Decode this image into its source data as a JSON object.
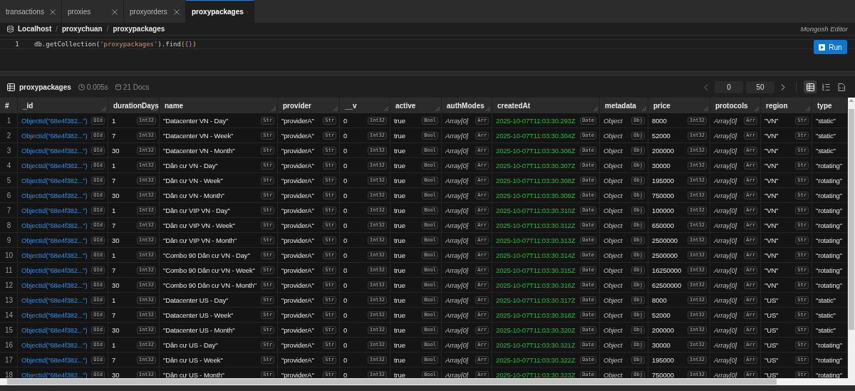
{
  "tabs": [
    {
      "label": "transactions",
      "selected": false
    },
    {
      "label": "proxies",
      "selected": false
    },
    {
      "label": "proxyorders",
      "selected": false
    },
    {
      "label": "proxypackages",
      "selected": true
    }
  ],
  "breadcrumb": [
    "Localhost",
    "proxychuan",
    "proxypackages"
  ],
  "breadcrumb_separators": [
    "/",
    "/"
  ],
  "editor_label": "Mongosh Editor",
  "code_lines": [
    {
      "number": "1",
      "tokens": [
        {
          "text": "db.getCollection(",
          "kind": "plain"
        },
        {
          "text": "'proxypackages'",
          "kind": "string"
        },
        {
          "text": ").find",
          "kind": "plain"
        },
        {
          "text": "(",
          "kind": "paren"
        },
        {
          "text": "{}",
          "kind": "brace"
        },
        {
          "text": ")",
          "kind": "paren"
        }
      ]
    }
  ],
  "run_button": "Run",
  "results": {
    "collection": "proxypackages",
    "time": "0.005s",
    "docs": "21 Docs",
    "skip": "0",
    "limit": "50",
    "views": [
      {
        "kind": "table",
        "selected": true
      },
      {
        "kind": "tree",
        "selected": false
      },
      {
        "kind": "json",
        "selected": false
      }
    ]
  },
  "table": {
    "columns": [
      {
        "label": "#",
        "kind": "index"
      },
      {
        "label": "_id",
        "kind": "id"
      },
      {
        "label": "durationDays",
        "kind": "num"
      },
      {
        "label": "name",
        "kind": "str"
      },
      {
        "label": "provider",
        "kind": "str"
      },
      {
        "label": "__v",
        "kind": "num"
      },
      {
        "label": "active",
        "kind": "bool"
      },
      {
        "label": "authModes",
        "kind": "arr"
      },
      {
        "label": "createdAt",
        "kind": "date"
      },
      {
        "label": "metadata",
        "kind": "obj"
      },
      {
        "label": "price",
        "kind": "num"
      },
      {
        "label": "protocols",
        "kind": "arr"
      },
      {
        "label": "region",
        "kind": "str"
      },
      {
        "label": "type",
        "kind": "str"
      }
    ],
    "rows": [
      {
        "cells": [
          [
            "1"
          ],
          [
            "ObjectId(\"68e4f382...\")",
            "OId"
          ],
          [
            "1",
            "Int32"
          ],
          [
            "\"Datacenter VN - Day\"",
            "Str"
          ],
          [
            "\"providerA\"",
            "Str"
          ],
          [
            "0",
            "Int32"
          ],
          [
            "true",
            "Bool"
          ],
          [
            "Array[0]",
            "Arr"
          ],
          [
            "2025-10-07T11:03:30.293Z",
            "Date"
          ],
          [
            "Object",
            "Obj"
          ],
          [
            "8000",
            "Int32"
          ],
          [
            "Array[0]",
            "Arr"
          ],
          [
            "\"VN\"",
            "Str"
          ],
          [
            "\"static\""
          ]
        ]
      },
      {
        "cells": [
          [
            "2"
          ],
          [
            "ObjectId(\"68e4f382...\")",
            "OId"
          ],
          [
            "7",
            "Int32"
          ],
          [
            "\"Datacenter VN - Week\"",
            "Str"
          ],
          [
            "\"providerA\"",
            "Str"
          ],
          [
            "0",
            "Int32"
          ],
          [
            "true",
            "Bool"
          ],
          [
            "Array[0]",
            "Arr"
          ],
          [
            "2025-10-07T11:03:30.304Z",
            "Date"
          ],
          [
            "Object",
            "Obj"
          ],
          [
            "52000",
            "Int32"
          ],
          [
            "Array[0]",
            "Arr"
          ],
          [
            "\"VN\"",
            "Str"
          ],
          [
            "\"static\""
          ]
        ]
      },
      {
        "cells": [
          [
            "3"
          ],
          [
            "ObjectId(\"68e4f382...\")",
            "OId"
          ],
          [
            "30",
            "Int32"
          ],
          [
            "\"Datacenter VN - Month\"",
            "Str"
          ],
          [
            "\"providerA\"",
            "Str"
          ],
          [
            "0",
            "Int32"
          ],
          [
            "true",
            "Bool"
          ],
          [
            "Array[0]",
            "Arr"
          ],
          [
            "2025-10-07T11:03:30.306Z",
            "Date"
          ],
          [
            "Object",
            "Obj"
          ],
          [
            "200000",
            "Int32"
          ],
          [
            "Array[0]",
            "Arr"
          ],
          [
            "\"VN\"",
            "Str"
          ],
          [
            "\"static\""
          ]
        ]
      },
      {
        "cells": [
          [
            "4"
          ],
          [
            "ObjectId(\"68e4f382...\")",
            "OId"
          ],
          [
            "1",
            "Int32"
          ],
          [
            "\"Dân cư VN - Day\"",
            "Str"
          ],
          [
            "\"providerA\"",
            "Str"
          ],
          [
            "0",
            "Int32"
          ],
          [
            "true",
            "Bool"
          ],
          [
            "Array[0]",
            "Arr"
          ],
          [
            "2025-10-07T11:03:30.307Z",
            "Date"
          ],
          [
            "Object",
            "Obj"
          ],
          [
            "30000",
            "Int32"
          ],
          [
            "Array[0]",
            "Arr"
          ],
          [
            "\"VN\"",
            "Str"
          ],
          [
            "\"rotating\""
          ]
        ]
      },
      {
        "cells": [
          [
            "5"
          ],
          [
            "ObjectId(\"68e4f382...\")",
            "OId"
          ],
          [
            "7",
            "Int32"
          ],
          [
            "\"Dân cư VN - Week\"",
            "Str"
          ],
          [
            "\"providerA\"",
            "Str"
          ],
          [
            "0",
            "Int32"
          ],
          [
            "true",
            "Bool"
          ],
          [
            "Array[0]",
            "Arr"
          ],
          [
            "2025-10-07T11:03:30.308Z",
            "Date"
          ],
          [
            "Object",
            "Obj"
          ],
          [
            "195000",
            "Int32"
          ],
          [
            "Array[0]",
            "Arr"
          ],
          [
            "\"VN\"",
            "Str"
          ],
          [
            "\"rotating\""
          ]
        ]
      },
      {
        "cells": [
          [
            "6"
          ],
          [
            "ObjectId(\"68e4f382...\")",
            "OId"
          ],
          [
            "30",
            "Int32"
          ],
          [
            "\"Dân cư VN - Month\"",
            "Str"
          ],
          [
            "\"providerA\"",
            "Str"
          ],
          [
            "0",
            "Int32"
          ],
          [
            "true",
            "Bool"
          ],
          [
            "Array[0]",
            "Arr"
          ],
          [
            "2025-10-07T11:03:30.309Z",
            "Date"
          ],
          [
            "Object",
            "Obj"
          ],
          [
            "750000",
            "Int32"
          ],
          [
            "Array[0]",
            "Arr"
          ],
          [
            "\"VN\"",
            "Str"
          ],
          [
            "\"rotating\""
          ]
        ]
      },
      {
        "cells": [
          [
            "7"
          ],
          [
            "ObjectId(\"68e4f382...\")",
            "OId"
          ],
          [
            "1",
            "Int32"
          ],
          [
            "\"Dân cư VIP VN - Day\"",
            "Str"
          ],
          [
            "\"providerA\"",
            "Str"
          ],
          [
            "0",
            "Int32"
          ],
          [
            "true",
            "Bool"
          ],
          [
            "Array[0]",
            "Arr"
          ],
          [
            "2025-10-07T11:03:30.310Z",
            "Date"
          ],
          [
            "Object",
            "Obj"
          ],
          [
            "100000",
            "Int32"
          ],
          [
            "Array[0]",
            "Arr"
          ],
          [
            "\"VN\"",
            "Str"
          ],
          [
            "\"rotating\""
          ]
        ]
      },
      {
        "cells": [
          [
            "8"
          ],
          [
            "ObjectId(\"68e4f382...\")",
            "OId"
          ],
          [
            "7",
            "Int32"
          ],
          [
            "\"Dân cư VIP VN - Week\"",
            "Str"
          ],
          [
            "\"providerA\"",
            "Str"
          ],
          [
            "0",
            "Int32"
          ],
          [
            "true",
            "Bool"
          ],
          [
            "Array[0]",
            "Arr"
          ],
          [
            "2025-10-07T11:03:30.312Z",
            "Date"
          ],
          [
            "Object",
            "Obj"
          ],
          [
            "650000",
            "Int32"
          ],
          [
            "Array[0]",
            "Arr"
          ],
          [
            "\"VN\"",
            "Str"
          ],
          [
            "\"rotating\""
          ]
        ]
      },
      {
        "cells": [
          [
            "9"
          ],
          [
            "ObjectId(\"68e4f382...\")",
            "OId"
          ],
          [
            "30",
            "Int32"
          ],
          [
            "\"Dân cư VIP VN - Month\"",
            "Str"
          ],
          [
            "\"providerA\"",
            "Str"
          ],
          [
            "0",
            "Int32"
          ],
          [
            "true",
            "Bool"
          ],
          [
            "Array[0]",
            "Arr"
          ],
          [
            "2025-10-07T11:03:30.313Z",
            "Date"
          ],
          [
            "Object",
            "Obj"
          ],
          [
            "2500000",
            "Int32"
          ],
          [
            "Array[0]",
            "Arr"
          ],
          [
            "\"VN\"",
            "Str"
          ],
          [
            "\"rotating\""
          ]
        ]
      },
      {
        "cells": [
          [
            "10"
          ],
          [
            "ObjectId(\"68e4f382...\")",
            "OId"
          ],
          [
            "1",
            "Int32"
          ],
          [
            "\"Combo 90 Dân cư VN - Day\"",
            "Str"
          ],
          [
            "\"providerA\"",
            "Str"
          ],
          [
            "0",
            "Int32"
          ],
          [
            "true",
            "Bool"
          ],
          [
            "Array[0]",
            "Arr"
          ],
          [
            "2025-10-07T11:03:30.314Z",
            "Date"
          ],
          [
            "Object",
            "Obj"
          ],
          [
            "2500000",
            "Int32"
          ],
          [
            "Array[0]",
            "Arr"
          ],
          [
            "\"VN\"",
            "Str"
          ],
          [
            "\"rotating\""
          ]
        ]
      },
      {
        "cells": [
          [
            "11"
          ],
          [
            "ObjectId(\"68e4f382...\")",
            "OId"
          ],
          [
            "7",
            "Int32"
          ],
          [
            "\"Combo 90 Dân cư VN - Week\"",
            "Str"
          ],
          [
            "\"providerA\"",
            "Str"
          ],
          [
            "0",
            "Int32"
          ],
          [
            "true",
            "Bool"
          ],
          [
            "Array[0]",
            "Arr"
          ],
          [
            "2025-10-07T11:03:30.315Z",
            "Date"
          ],
          [
            "Object",
            "Obj"
          ],
          [
            "16250000",
            "Int32"
          ],
          [
            "Array[0]",
            "Arr"
          ],
          [
            "\"VN\"",
            "Str"
          ],
          [
            "\"rotating\""
          ]
        ]
      },
      {
        "cells": [
          [
            "12"
          ],
          [
            "ObjectId(\"68e4f382...\")",
            "OId"
          ],
          [
            "30",
            "Int32"
          ],
          [
            "\"Combo 90 Dân cư VN - Month\"",
            "Str"
          ],
          [
            "\"providerA\"",
            "Str"
          ],
          [
            "0",
            "Int32"
          ],
          [
            "true",
            "Bool"
          ],
          [
            "Array[0]",
            "Arr"
          ],
          [
            "2025-10-07T11:03:30.316Z",
            "Date"
          ],
          [
            "Object",
            "Obj"
          ],
          [
            "62500000",
            "Int32"
          ],
          [
            "Array[0]",
            "Arr"
          ],
          [
            "\"VN\"",
            "Str"
          ],
          [
            "\"rotating\""
          ]
        ]
      },
      {
        "cells": [
          [
            "13"
          ],
          [
            "ObjectId(\"68e4f382...\")",
            "OId"
          ],
          [
            "1",
            "Int32"
          ],
          [
            "\"Datacenter US - Day\"",
            "Str"
          ],
          [
            "\"providerA\"",
            "Str"
          ],
          [
            "0",
            "Int32"
          ],
          [
            "true",
            "Bool"
          ],
          [
            "Array[0]",
            "Arr"
          ],
          [
            "2025-10-07T11:03:30.317Z",
            "Date"
          ],
          [
            "Object",
            "Obj"
          ],
          [
            "8000",
            "Int32"
          ],
          [
            "Array[0]",
            "Arr"
          ],
          [
            "\"US\"",
            "Str"
          ],
          [
            "\"static\""
          ]
        ]
      },
      {
        "cells": [
          [
            "14"
          ],
          [
            "ObjectId(\"68e4f382...\")",
            "OId"
          ],
          [
            "7",
            "Int32"
          ],
          [
            "\"Datacenter US - Week\"",
            "Str"
          ],
          [
            "\"providerA\"",
            "Str"
          ],
          [
            "0",
            "Int32"
          ],
          [
            "true",
            "Bool"
          ],
          [
            "Array[0]",
            "Arr"
          ],
          [
            "2025-10-07T11:03:30.318Z",
            "Date"
          ],
          [
            "Object",
            "Obj"
          ],
          [
            "52000",
            "Int32"
          ],
          [
            "Array[0]",
            "Arr"
          ],
          [
            "\"US\"",
            "Str"
          ],
          [
            "\"static\""
          ]
        ]
      },
      {
        "cells": [
          [
            "15"
          ],
          [
            "ObjectId(\"68e4f382...\")",
            "OId"
          ],
          [
            "30",
            "Int32"
          ],
          [
            "\"Datacenter US - Month\"",
            "Str"
          ],
          [
            "\"providerA\"",
            "Str"
          ],
          [
            "0",
            "Int32"
          ],
          [
            "true",
            "Bool"
          ],
          [
            "Array[0]",
            "Arr"
          ],
          [
            "2025-10-07T11:03:30.320Z",
            "Date"
          ],
          [
            "Object",
            "Obj"
          ],
          [
            "200000",
            "Int32"
          ],
          [
            "Array[0]",
            "Arr"
          ],
          [
            "\"US\"",
            "Str"
          ],
          [
            "\"static\""
          ]
        ]
      },
      {
        "cells": [
          [
            "16"
          ],
          [
            "ObjectId(\"68e4f382...\")",
            "OId"
          ],
          [
            "1",
            "Int32"
          ],
          [
            "\"Dân cư US - Day\"",
            "Str"
          ],
          [
            "\"providerA\"",
            "Str"
          ],
          [
            "0",
            "Int32"
          ],
          [
            "true",
            "Bool"
          ],
          [
            "Array[0]",
            "Arr"
          ],
          [
            "2025-10-07T11:03:30.321Z",
            "Date"
          ],
          [
            "Object",
            "Obj"
          ],
          [
            "30000",
            "Int32"
          ],
          [
            "Array[0]",
            "Arr"
          ],
          [
            "\"US\"",
            "Str"
          ],
          [
            "\"rotating\""
          ]
        ]
      },
      {
        "cells": [
          [
            "17"
          ],
          [
            "ObjectId(\"68e4f382...\")",
            "OId"
          ],
          [
            "7",
            "Int32"
          ],
          [
            "\"Dân cư US - Week\"",
            "Str"
          ],
          [
            "\"providerA\"",
            "Str"
          ],
          [
            "0",
            "Int32"
          ],
          [
            "true",
            "Bool"
          ],
          [
            "Array[0]",
            "Arr"
          ],
          [
            "2025-10-07T11:03:30.322Z",
            "Date"
          ],
          [
            "Object",
            "Obj"
          ],
          [
            "195000",
            "Int32"
          ],
          [
            "Array[0]",
            "Arr"
          ],
          [
            "\"US\"",
            "Str"
          ],
          [
            "\"rotating\""
          ]
        ]
      },
      {
        "cells": [
          [
            "18"
          ],
          [
            "ObjectId(\"68e4f382...\")",
            "OId"
          ],
          [
            "30",
            "Int32"
          ],
          [
            "\"Dân cư US - Month\"",
            "Str"
          ],
          [
            "\"providerA\"",
            "Str"
          ],
          [
            "0",
            "Int32"
          ],
          [
            "true",
            "Bool"
          ],
          [
            "Array[0]",
            "Arr"
          ],
          [
            "2025-10-07T11:03:30.323Z",
            "Date"
          ],
          [
            "Object",
            "Obj"
          ],
          [
            "750000",
            "Int32"
          ],
          [
            "Array[0]",
            "Arr"
          ],
          [
            "\"US\"",
            "Str"
          ],
          [
            "\"rotating\""
          ]
        ]
      }
    ]
  }
}
